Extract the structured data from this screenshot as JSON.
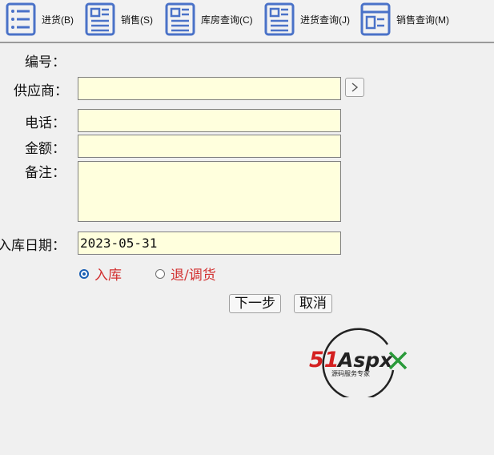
{
  "toolbar": {
    "items": [
      {
        "label": "进货(B)",
        "icon": "list-icon"
      },
      {
        "label": "销售(S)",
        "icon": "document-icon"
      },
      {
        "label": "库房查询(C)",
        "icon": "document-icon"
      },
      {
        "label": "进货查询(J)",
        "icon": "document-icon"
      },
      {
        "label": "销售查询(M)",
        "icon": "form-icon"
      }
    ]
  },
  "form": {
    "number_label": "编号：",
    "supplier_label": "供应商：",
    "phone_label": "电话：",
    "amount_label": "金额：",
    "remark_label": "备注：",
    "date_label": "入库日期：",
    "supplier_value": "",
    "phone_value": "",
    "amount_value": "",
    "remark_value": "",
    "date_value": "2023-05-31",
    "radio_in_label": "入库",
    "radio_return_label": "退/调货",
    "radio_selected": "入库",
    "next_label": "下一步",
    "cancel_label": "取消"
  },
  "logo": {
    "brand_main": "51",
    "brand_rest": "Aspx",
    "tagline": "源码服务专家"
  },
  "colors": {
    "accent": "#4a72c8",
    "field_bg": "#ffffdd",
    "radio_text": "#d23030",
    "logo_red": "#d42020",
    "logo_green": "#2a9a3a"
  }
}
